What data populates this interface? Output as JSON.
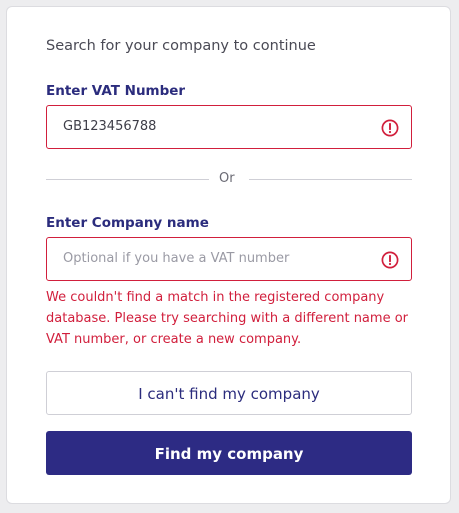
{
  "form": {
    "heading": "Search for your company to continue",
    "vat": {
      "label": "Enter VAT Number",
      "value": "GB123456788",
      "error_icon": "alert-circle-icon"
    },
    "divider_text": "Or",
    "company": {
      "label": "Enter Company name",
      "placeholder": "Optional if you have a VAT number",
      "error_icon": "alert-circle-icon"
    },
    "error_message": "We couldn't find a match in the registered company database. Please try searching with a different name or VAT number, or create a new company.",
    "secondary_button": "I can't find my company",
    "primary_button": "Find my company"
  },
  "colors": {
    "error": "#d11f3c",
    "brand": "#2d2b84",
    "label": "#2b2c7d"
  }
}
